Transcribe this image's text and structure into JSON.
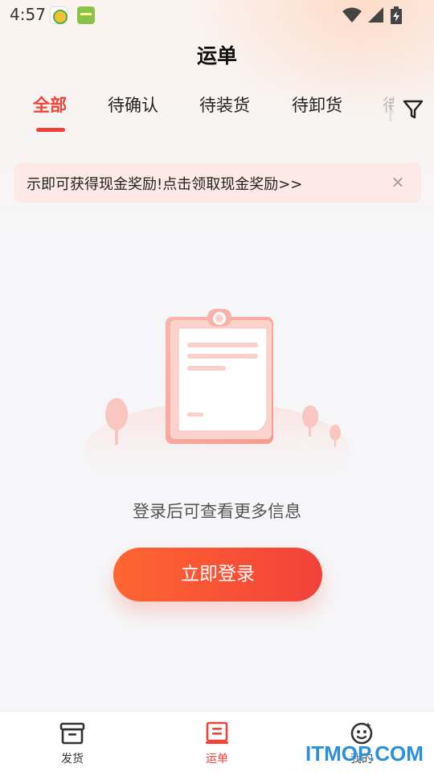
{
  "status_bar": {
    "time": "4:57",
    "icons": [
      "app-badge-icon",
      "app-badge-icon",
      "wifi-icon",
      "signal-icon",
      "battery-charging-icon"
    ]
  },
  "header": {
    "title": "运单"
  },
  "tabs": [
    {
      "label": "全部",
      "active": true
    },
    {
      "label": "待确认",
      "active": false
    },
    {
      "label": "待装货",
      "active": false
    },
    {
      "label": "待卸货",
      "active": false
    }
  ],
  "filter_icon": "filter-icon",
  "banner": {
    "text": "示即可获得现金奖励!点击领取现金奖励>>",
    "close": "×"
  },
  "empty_state": {
    "message": "登录后可查看更多信息",
    "login_label": "立即登录"
  },
  "bottom_nav": [
    {
      "label": "发货",
      "icon": "box-icon",
      "active": false
    },
    {
      "label": "运单",
      "icon": "waybill-icon",
      "active": true
    },
    {
      "label": "我的",
      "icon": "smiley-icon",
      "active": false
    }
  ],
  "watermark": "ITMOP.COM",
  "colors": {
    "accent": "#f04237",
    "button_start": "#fe6631",
    "button_end": "#f2413a",
    "banner_bg": "#fde9e6"
  }
}
